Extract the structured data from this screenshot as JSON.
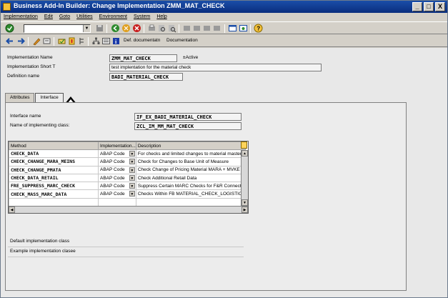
{
  "window": {
    "title": "Business Add-In Builder: Change Implementation ZMM_MAT_CHECK",
    "controls": [
      "_",
      "□",
      "X"
    ]
  },
  "menu": [
    "Implementation",
    "Edit",
    "Goto",
    "Utilities",
    "Environment",
    "System",
    "Help"
  ],
  "toolbar2": {
    "def_doc_label": "Def. documentatn",
    "doc_label": "Documentation"
  },
  "header": {
    "impl_name_label": "Implementation Name",
    "impl_name_value": "ZMM_MAT_CHECK",
    "status": "Active",
    "short_text_label": "Implementation Short T",
    "short_text_value": "test implentation for the material check",
    "def_name_label": "Definition name",
    "def_name_value": "BADI_MATERIAL_CHECK"
  },
  "tabs": [
    "Attributes",
    "Interface"
  ],
  "interface": {
    "name_label": "Interface name",
    "name_value": "IF_EX_BADI_MATERIAL_CHECK",
    "class_label": "Name of implementing class:",
    "class_value": "ZCL_IM_MM_MAT_CHECK"
  },
  "table": {
    "headers": [
      "Method",
      "Implementation...",
      "Description"
    ],
    "rows": [
      {
        "method": "CHECK_DATA",
        "impl": "ABAP Code",
        "desc": "For checks and limited changes to material master fi"
      },
      {
        "method": "CHECK_CHANGE_MARA_MEINS",
        "impl": "ABAP Code",
        "desc": "Check for Changes to Base Unit of Measure"
      },
      {
        "method": "CHECK_CHANGE_PMATA",
        "impl": "ABAP Code",
        "desc": "Check Change of Pricing Material MARA + MVKE"
      },
      {
        "method": "CHECK_DATA_RETAIL",
        "impl": "ABAP Code",
        "desc": "Check Additional Retail Data"
      },
      {
        "method": "FRE_SUPPRESS_MARC_CHECK",
        "impl": "ABAP Code",
        "desc": "Suppress Certain MARC Checks for F&R Connectio"
      },
      {
        "method": "CHECK_MASS_MARC_DATA",
        "impl": "ABAP Code",
        "desc": "Checks Within FB MATERIAL_CHECK_LOGISTIC_"
      }
    ]
  },
  "footer": {
    "default_class_label": "Default implementation class",
    "example_class_label": "Example implementation clasee"
  }
}
